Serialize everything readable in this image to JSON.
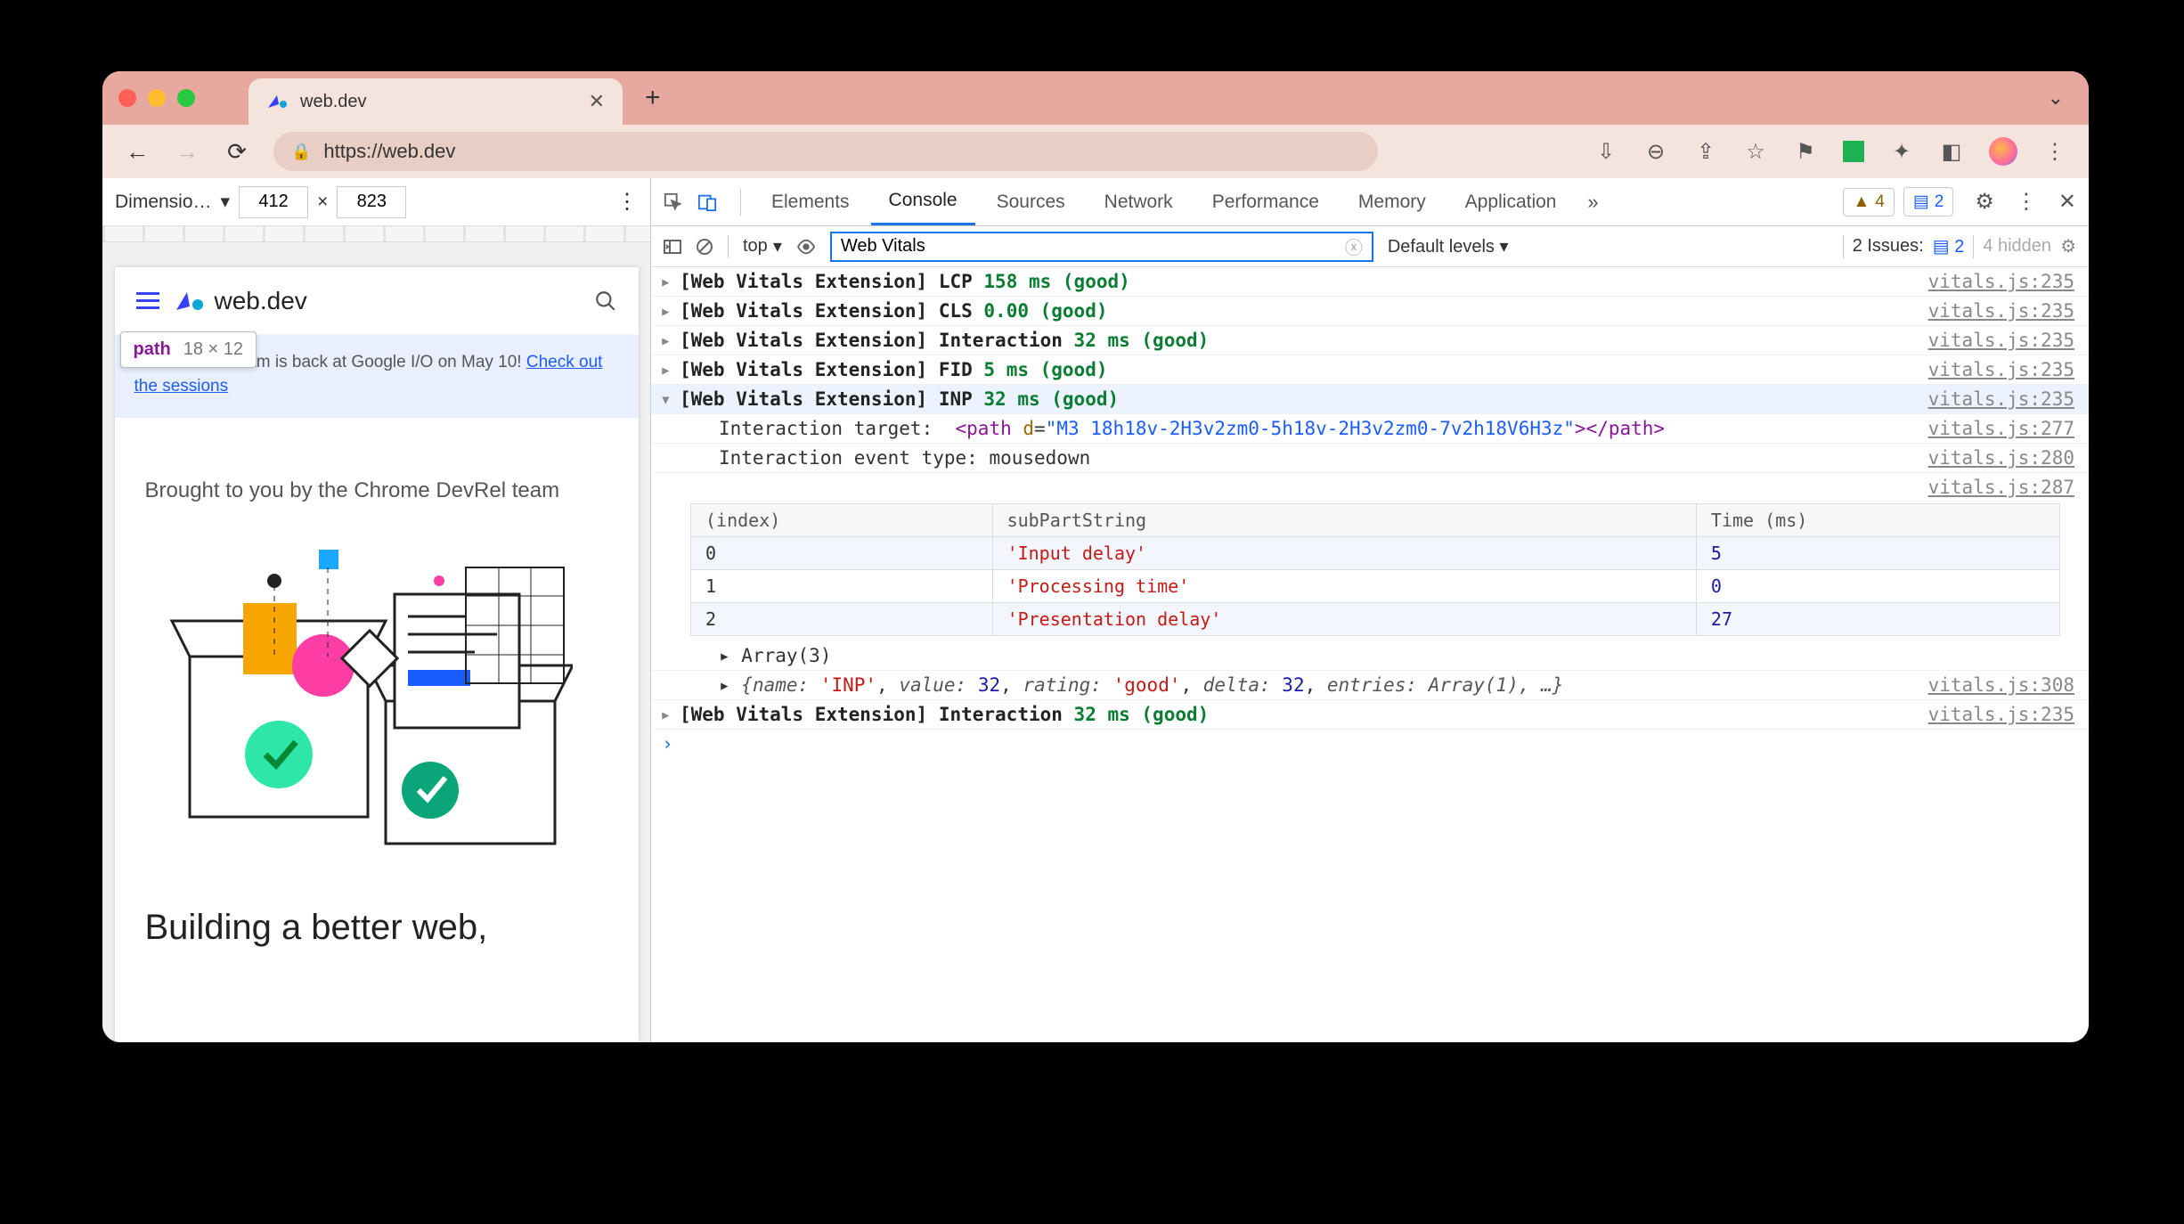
{
  "browser": {
    "tab_title": "web.dev",
    "url": "https://web.dev",
    "new_tab_tooltip": "+",
    "nav": {
      "back": "←",
      "fwd": "→",
      "reload": "↻"
    }
  },
  "responsive_bar": {
    "label": "Dimensio…",
    "width": "412",
    "height": "823",
    "times": "×"
  },
  "inspect_tooltip": {
    "tag": "path",
    "size": "18 × 12"
  },
  "page_preview": {
    "site_name": "web.dev",
    "banner_text": "The Chrome team is back at Google I/O on May 10! ",
    "banner_link": "Check out the sessions",
    "brought": "Brought to you by the Chrome DevRel team",
    "hero": "Building a better web,"
  },
  "devtools": {
    "tabs": [
      "Elements",
      "Console",
      "Sources",
      "Network",
      "Performance",
      "Memory",
      "Application"
    ],
    "active_tab": "Console",
    "warn_count": "4",
    "info_count": "2",
    "console_toolbar": {
      "context": "top",
      "filter_value": "Web Vitals",
      "levels": "Default levels",
      "issues_label": "2 Issues:",
      "issues_count": "2",
      "hidden": "4 hidden"
    },
    "logs": [
      {
        "prefix": "[Web Vitals Extension]",
        "metric": "LCP",
        "val": "158 ms (good)",
        "src": "vitals.js:235"
      },
      {
        "prefix": "[Web Vitals Extension]",
        "metric": "CLS",
        "val": "0.00 (good)",
        "src": "vitals.js:235"
      },
      {
        "prefix": "[Web Vitals Extension]",
        "metric": "Interaction",
        "val": "32 ms (good)",
        "src": "vitals.js:235"
      },
      {
        "prefix": "[Web Vitals Extension]",
        "metric": "FID",
        "val": "5 ms (good)",
        "src": "vitals.js:235"
      },
      {
        "prefix": "[Web Vitals Extension]",
        "metric": "INP",
        "val": "32 ms (good)",
        "src": "vitals.js:235",
        "expanded": true
      }
    ],
    "expanded": {
      "target_label": "Interaction target:",
      "target_val_open": "<path ",
      "target_attr_n": "d",
      "target_attr_v": "\"M3 18h18v-2H3v2zm0-5h18v-2H3v2zm0-7v2h18V6H3z\"",
      "target_val_close": "></path>",
      "target_src": "vitals.js:277",
      "evtype_label": "Interaction event type:",
      "evtype_val": "mousedown",
      "evtype_src": "vitals.js:280",
      "table_src": "vitals.js:287",
      "table_headers": [
        "(index)",
        "subPartString",
        "Time (ms)"
      ],
      "table_rows": [
        {
          "i": "0",
          "s": "'Input delay'",
          "t": "5"
        },
        {
          "i": "1",
          "s": "'Processing time'",
          "t": "0"
        },
        {
          "i": "2",
          "s": "'Presentation delay'",
          "t": "27"
        }
      ],
      "array_label": "Array(3)",
      "obj_repr_open": "{",
      "obj_parts": [
        {
          "k": "name:",
          "v": "'INP'",
          "cls": "str"
        },
        {
          "k": "value:",
          "v": "32",
          "cls": "num"
        },
        {
          "k": "rating:",
          "v": "'good'",
          "cls": "str"
        },
        {
          "k": "delta:",
          "v": "32",
          "cls": "num"
        },
        {
          "k": "entries:",
          "v": "Array(1)",
          "cls": "k"
        }
      ],
      "obj_repr_close": ", …}",
      "obj_src": "vitals.js:308"
    },
    "trailing_log": {
      "prefix": "[Web Vitals Extension]",
      "metric": "Interaction",
      "val": "32 ms (good)",
      "src": "vitals.js:235"
    }
  }
}
